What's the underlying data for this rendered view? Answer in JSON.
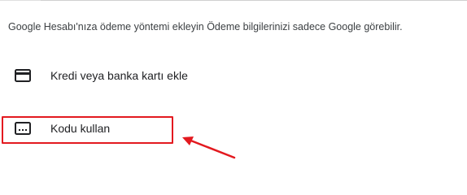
{
  "description": "Google Hesabı'nıza ödeme yöntemi ekleyin Ödeme bilgilerinizi sadece Google görebilir.",
  "payment_methods": [
    {
      "label": "Kredi veya banka kartı ekle",
      "icon": "credit-card-icon"
    },
    {
      "label": "Kodu kullan",
      "icon": "redeem-code-icon"
    }
  ],
  "annotation": {
    "highlight_color": "#e3191f",
    "highlighted_item": "Kodu kullan"
  }
}
